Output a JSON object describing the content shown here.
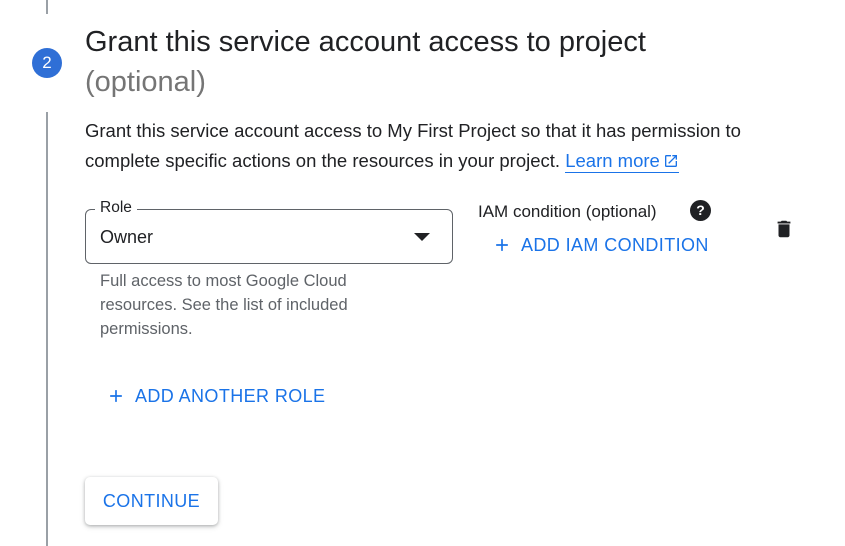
{
  "step": {
    "number": "2",
    "title": "Grant this service account access to project",
    "title_optional": "(optional)",
    "description": "Grant this service account access to My First Project so that it has permission to complete specific actions on the resources in your project.",
    "learn_more": "Learn more"
  },
  "role": {
    "label": "Role",
    "value": "Owner",
    "hint": "Full access to most Google Cloud resources. See the list of included permissions."
  },
  "iam_condition": {
    "label": "IAM condition (optional)",
    "help_glyph": "?",
    "add_label": "ADD IAM CONDITION"
  },
  "add_another_role_label": "ADD ANOTHER ROLE",
  "continue_label": "CONTINUE",
  "colors": {
    "accent": "#1a73e8",
    "step_circle": "#2f6fd6",
    "text": "#202124",
    "muted": "#5f6368"
  },
  "icons": [
    "external-link-icon",
    "chevron-down-icon",
    "help-icon",
    "plus-icon",
    "trash-icon"
  ]
}
